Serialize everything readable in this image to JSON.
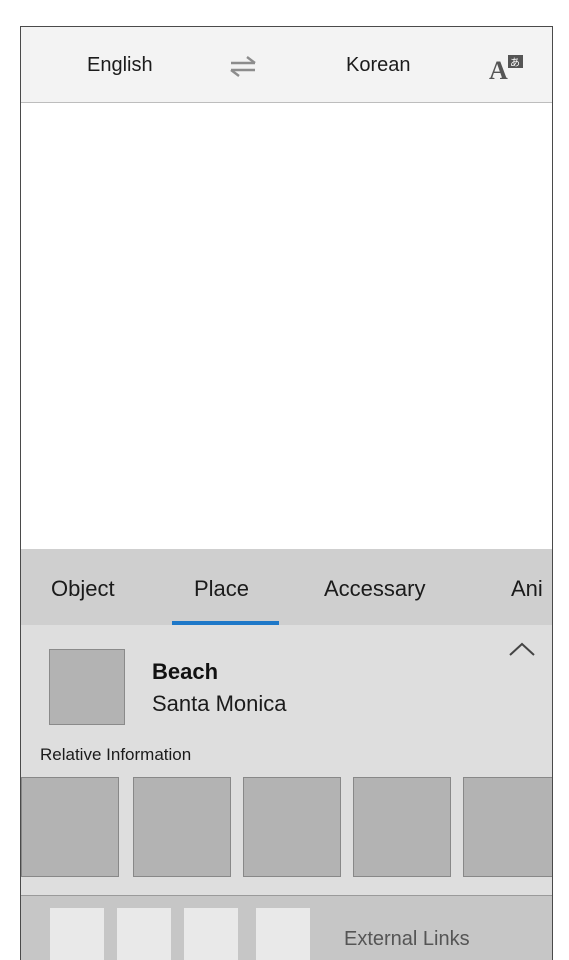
{
  "header": {
    "source_language": "English",
    "target_language": "Korean",
    "swap_icon": "swap-arrows-icon",
    "font_icon": "translate-font-icon"
  },
  "tabs": [
    {
      "label": "Object"
    },
    {
      "label": "Place",
      "selected": true
    },
    {
      "label": "Accessary"
    },
    {
      "label": "Ani"
    }
  ],
  "result": {
    "title": "Beach",
    "subtitle": "Santa Monica",
    "relative_label": "Relative Information",
    "relative_count": 5
  },
  "footer": {
    "external_links_label": "External Links"
  },
  "colors": {
    "accent": "#1e78c8",
    "tab_bg": "#cfcfcf",
    "panel_bg": "#dedede"
  }
}
